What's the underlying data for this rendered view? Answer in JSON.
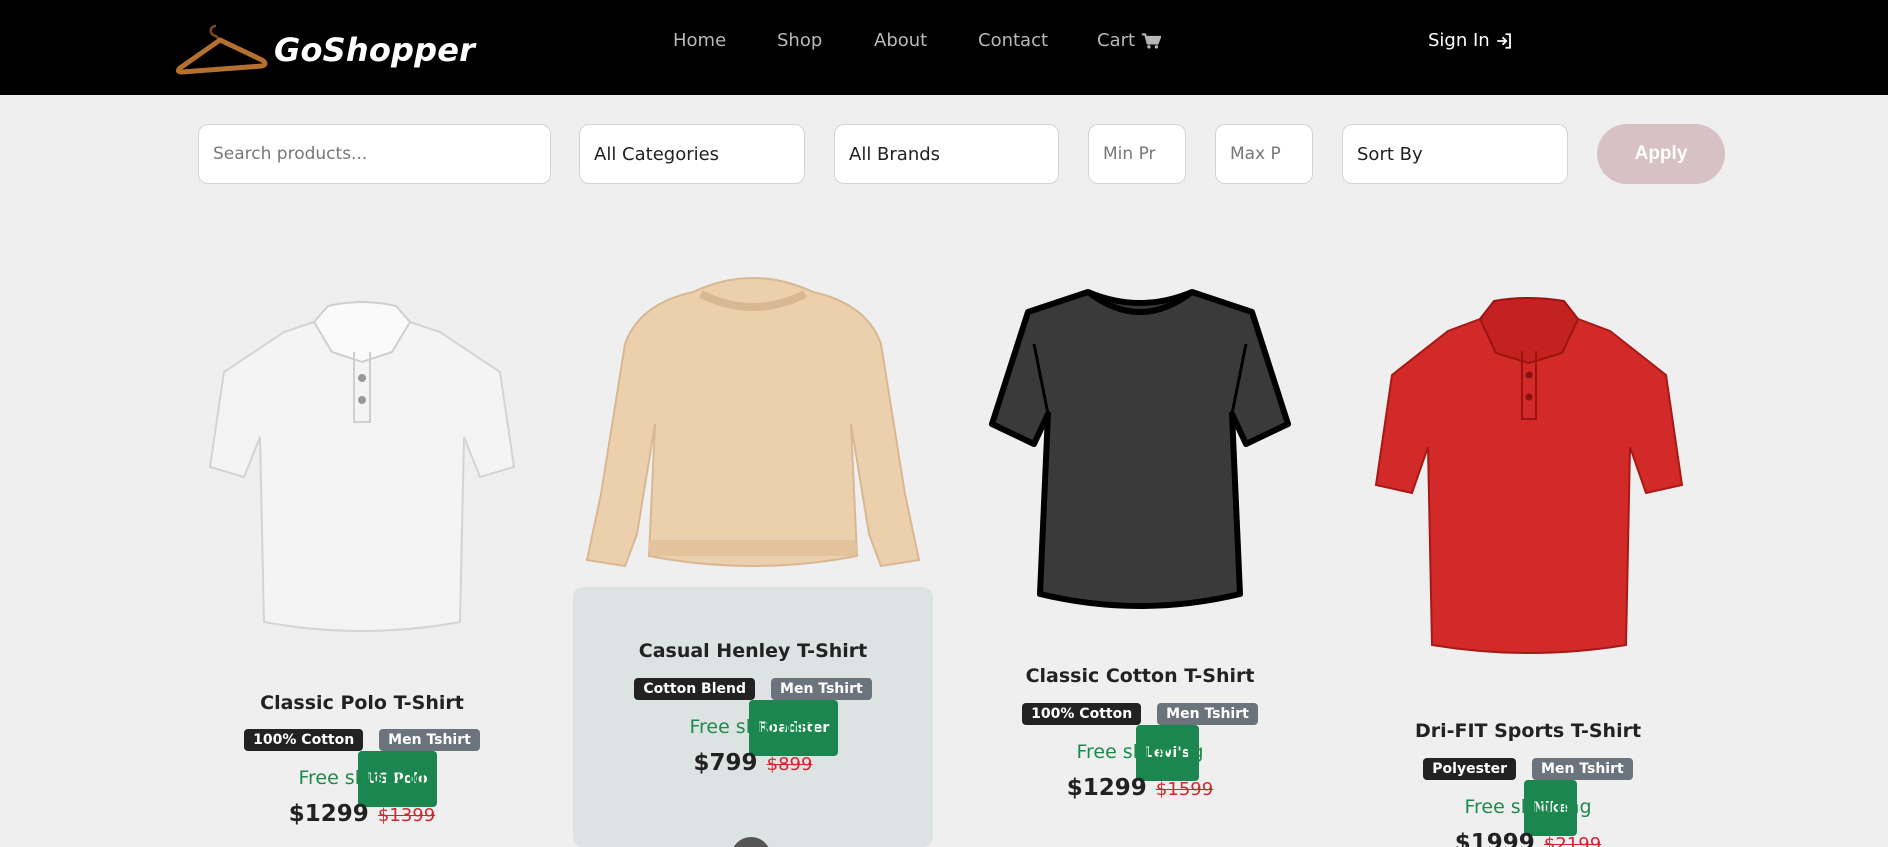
{
  "nav": {
    "brand": "GoShopper",
    "links": [
      "Home",
      "Shop",
      "About",
      "Contact",
      "Cart"
    ],
    "signin": "Sign In"
  },
  "filters": {
    "search_placeholder": "Search products...",
    "category": "All Categories",
    "brand": "All Brands",
    "min_price_placeholder": "Min Pr",
    "max_price_placeholder": "Max P",
    "sort": "Sort By",
    "apply": "Apply"
  },
  "products": [
    {
      "title": "Classic Polo T-Shirt",
      "badges": [
        "US Polo",
        "100% Cotton",
        "Men Tshirt"
      ],
      "shipping": "Free shipping",
      "price": "$1299",
      "old_price": "$1399",
      "image": "white-polo-shirt"
    },
    {
      "title": "Casual Henley T-Shirt",
      "badges": [
        "Roadster",
        "Cotton Blend",
        "Men Tshirt"
      ],
      "shipping": "Free shipping",
      "price": "$799",
      "old_price": "$899",
      "image": "beige-sweatshirt"
    },
    {
      "title": "Classic Cotton T-Shirt",
      "badges": [
        "Levi's",
        "100% Cotton",
        "Men Tshirt"
      ],
      "shipping": "Free shipping",
      "price": "$1299",
      "old_price": "$1599",
      "image": "black-tshirt"
    },
    {
      "title": "Dri-FIT Sports T-Shirt",
      "badges": [
        "Nike",
        "Polyester",
        "Men Tshirt"
      ],
      "shipping": "Free shipping",
      "price": "$1999",
      "old_price": "$2199",
      "image": "red-polo-shirt"
    }
  ],
  "colors": {
    "navbar": "#000000",
    "apply": "#d8c1c5",
    "brand_badge": "#1c8651",
    "shipping": "#1d8a4a",
    "old_price": "#d0262f"
  }
}
